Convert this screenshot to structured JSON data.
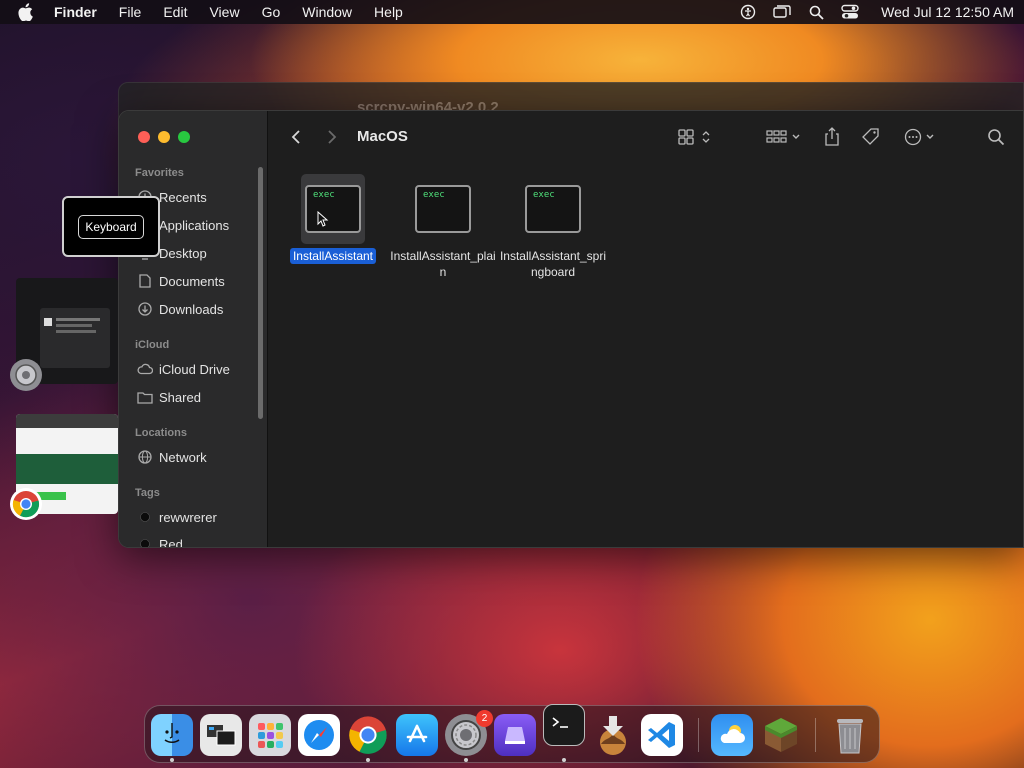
{
  "menubar": {
    "app_name": "Finder",
    "menus": [
      "File",
      "Edit",
      "View",
      "Go",
      "Window",
      "Help"
    ],
    "clock": "Wed Jul 12  12:50 AM",
    "status_icons": [
      "accessibility-icon",
      "screen-mirroring-icon",
      "spotlight-icon",
      "control-center-icon"
    ]
  },
  "background_window": {
    "title": "scrcpy-win64-v2.0.2"
  },
  "finder": {
    "folder_title": "MacOS",
    "sidebar": {
      "sections": [
        {
          "label": "Favorites",
          "items": [
            {
              "label": "Recents",
              "icon": "clock-icon"
            },
            {
              "label": "Applications",
              "icon": "applications-icon"
            },
            {
              "label": "Desktop",
              "icon": "desktop-icon"
            },
            {
              "label": "Documents",
              "icon": "document-icon"
            },
            {
              "label": "Downloads",
              "icon": "download-icon"
            }
          ]
        },
        {
          "label": "iCloud",
          "items": [
            {
              "label": "iCloud Drive",
              "icon": "cloud-icon"
            },
            {
              "label": "Shared",
              "icon": "shared-folder-icon"
            }
          ]
        },
        {
          "label": "Locations",
          "items": [
            {
              "label": "Network",
              "icon": "globe-icon"
            }
          ]
        },
        {
          "label": "Tags",
          "items": [
            {
              "label": "rewwrerer",
              "icon": "tag-dot-icon",
              "color": "#111111"
            },
            {
              "label": "Red",
              "icon": "tag-dot-icon",
              "color": "#111111"
            }
          ]
        }
      ]
    },
    "files": [
      {
        "name": "InstallAssistant",
        "badge": "exec",
        "selected": true
      },
      {
        "name": "InstallAssistant_plain",
        "badge": "exec",
        "selected": false
      },
      {
        "name": "InstallAssistant_springboard",
        "badge": "exec",
        "selected": false
      }
    ]
  },
  "keyboard_tooltip": {
    "label": "Keyboard"
  },
  "dock": {
    "items": [
      "Finder",
      "Preview",
      "Launchpad",
      "Safari",
      "Chrome",
      "App Store",
      "System Settings",
      "Simulator",
      "Terminal",
      "Install macOS",
      "Visual Studio Code",
      "Weather",
      "Minecraft",
      "Trash"
    ],
    "settings_badge": "2"
  },
  "colors": {
    "selection": "#1a5fd6",
    "exec_text": "#4fe07a",
    "close": "#fe5f57",
    "minimize": "#febc2e",
    "maximize": "#28c840"
  }
}
